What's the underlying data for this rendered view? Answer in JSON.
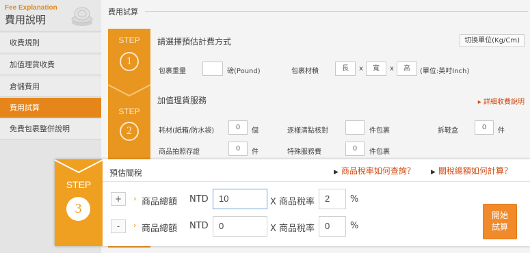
{
  "sidebar": {
    "header_en": "Fee Explanation",
    "header_zh": "費用說明",
    "items": [
      {
        "label": "收費規則"
      },
      {
        "label": "加值理貨收費"
      },
      {
        "label": "倉儲費用"
      },
      {
        "label": "費用試算",
        "active": true
      },
      {
        "label": "免費包裹整併說明"
      }
    ]
  },
  "main": {
    "title": "費用試算",
    "step_label": "STEP",
    "step1": {
      "number": "1",
      "title": "請選擇預估計費方式",
      "unit_button": "切換單位(Kg/Cm)",
      "weight_label": "包裹重量",
      "weight_value": "",
      "weight_unit": "磅(Pound)",
      "dim_label": "包裹材積",
      "length": "長",
      "width": "寬",
      "height": "高",
      "x": "x",
      "dim_unit": "(單位:英吋Inch)"
    },
    "step2": {
      "number": "2",
      "title": "加值理貨服務",
      "fee_link": "詳細收費說明",
      "material_label": "耗材(紙箱/防水袋)",
      "material_value": "0",
      "material_unit": "個",
      "count_label": "逐樣清點核對",
      "count_value": "",
      "count_unit": "件包裹",
      "unbox_label": "拆鞋盒",
      "unbox_value": "0",
      "unbox_unit": "件",
      "photo_label": "商品拍照存證",
      "photo_value": "0",
      "photo_unit": "件",
      "special_label": "特殊服務費",
      "special_value": "0",
      "special_unit": "件包裹"
    }
  },
  "tax": {
    "step_label": "STEP",
    "number": "3",
    "title": "預估關稅",
    "link1": "商品稅率如何查詢？",
    "link2": "關稅總額如何計算？",
    "rows": [
      {
        "btn": "+",
        "label": "商品總額",
        "currency": "NTD",
        "amount": "10",
        "x_label": "X 商品稅率",
        "rate": "2",
        "pct": "%"
      },
      {
        "btn": "-",
        "label": "商品總額",
        "currency": "NTD",
        "amount": "0",
        "x_label": "X 商品稅率",
        "rate": "0",
        "pct": "%"
      }
    ],
    "calc_line1": "開始",
    "calc_line2": "試算"
  },
  "colors": {
    "accent": "#e8961f",
    "overlay_accent": "#f0a020",
    "link": "#d04a10",
    "button": "#f08a2a"
  }
}
